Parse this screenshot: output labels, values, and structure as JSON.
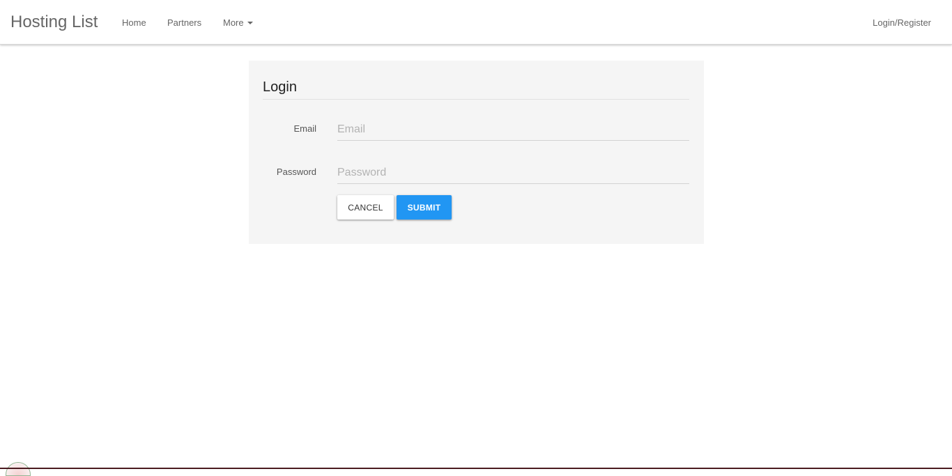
{
  "navbar": {
    "brand": "Hosting List",
    "links": {
      "home": "Home",
      "partners": "Partners",
      "more": "More"
    },
    "login_register": "Login/Register"
  },
  "login_form": {
    "title": "Login",
    "email": {
      "label": "Email",
      "placeholder": "Email",
      "value": ""
    },
    "password": {
      "label": "Password",
      "placeholder": "Password",
      "value": ""
    },
    "buttons": {
      "cancel": "CANCEL",
      "submit": "SUBMIT"
    }
  },
  "colors": {
    "accent": "#2196f3",
    "panel_background": "#f5f5f5"
  },
  "icons": {
    "more_dropdown": "caret-down-icon"
  }
}
